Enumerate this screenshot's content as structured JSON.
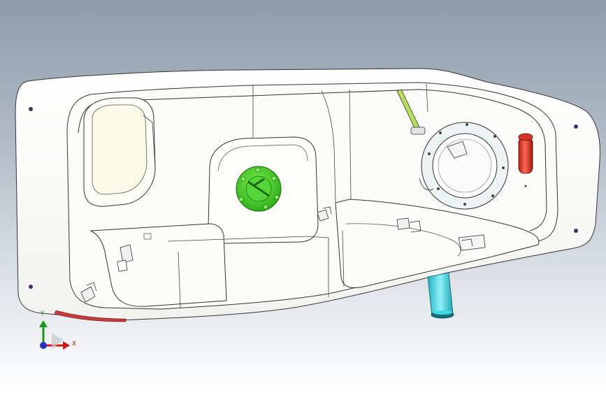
{
  "viewport": {
    "background_top": "#8e9bab",
    "background_bottom": "#ffffff"
  },
  "model": {
    "body_color": "#ffffff",
    "edge_color": "#3a3a3a",
    "fill_neck_color": "#33d6e0",
    "pump_flange_color": "#55dd33",
    "vent_tube_color": "#e23b2b",
    "lower_lip_color": "#c23c3c",
    "rod_color": "#a6d84a",
    "mount_hole_color": "#4a2a6a"
  },
  "triad": {
    "x_label": "X",
    "y_label": "Y",
    "x_color": "#d11414",
    "y_color": "#189818",
    "z_color": "#2233cc"
  }
}
